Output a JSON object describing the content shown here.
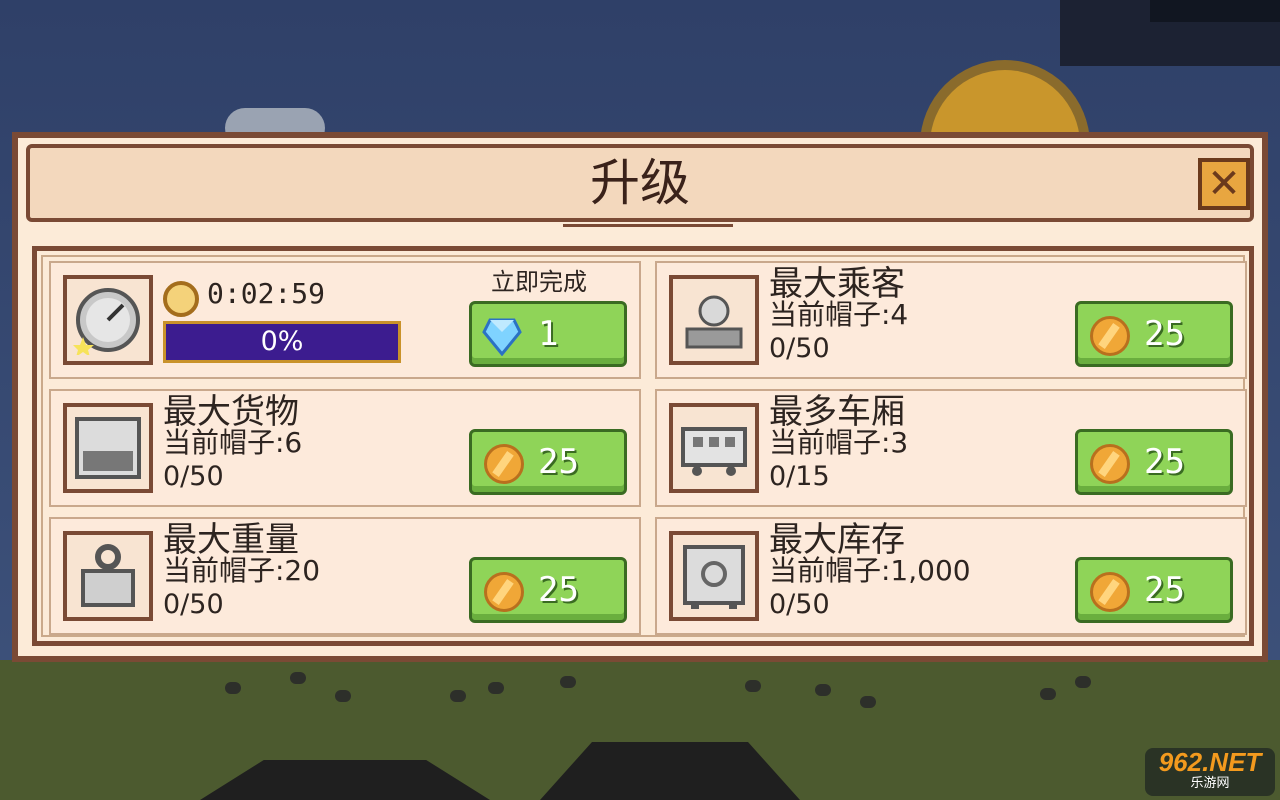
{
  "dialog": {
    "title": "升级",
    "close_icon": "close-x-icon"
  },
  "speed_card": {
    "icon": "speedometer-icon",
    "timer_icon": "stopwatch-icon",
    "timer": "0:02:59",
    "progress_percent": 0,
    "progress_label": "0%",
    "finish_label": "立即完成",
    "finish_cost": "1",
    "finish_currency_icon": "gem-icon"
  },
  "upgrades": [
    {
      "name": "最大乘客",
      "level": "当前帽子:4",
      "progress": "0/50",
      "price": "25",
      "icon": "passenger-icon"
    },
    {
      "name": "最大货物",
      "level": "当前帽子:6",
      "progress": "0/50",
      "price": "25",
      "icon": "cargo-crate-icon"
    },
    {
      "name": "最多车厢",
      "level": "当前帽子:3",
      "progress": "0/15",
      "price": "25",
      "icon": "train-car-icon"
    },
    {
      "name": "最大重量",
      "level": "当前帽子:20",
      "progress": "0/50",
      "price": "25",
      "icon": "weight-icon"
    },
    {
      "name": "最大库存",
      "level": "当前帽子:1,000",
      "progress": "0/50",
      "price": "25",
      "icon": "safe-icon"
    }
  ],
  "currency_icon": "coin-icon",
  "watermark": {
    "main": "962.NET",
    "sub": "乐游网"
  },
  "colors": {
    "dialog_bg": "#fcebd8",
    "border": "#7a4a35",
    "button_green": "#8fd458",
    "progress_bar": "#3c1c8f",
    "coin": "#f0a737"
  }
}
